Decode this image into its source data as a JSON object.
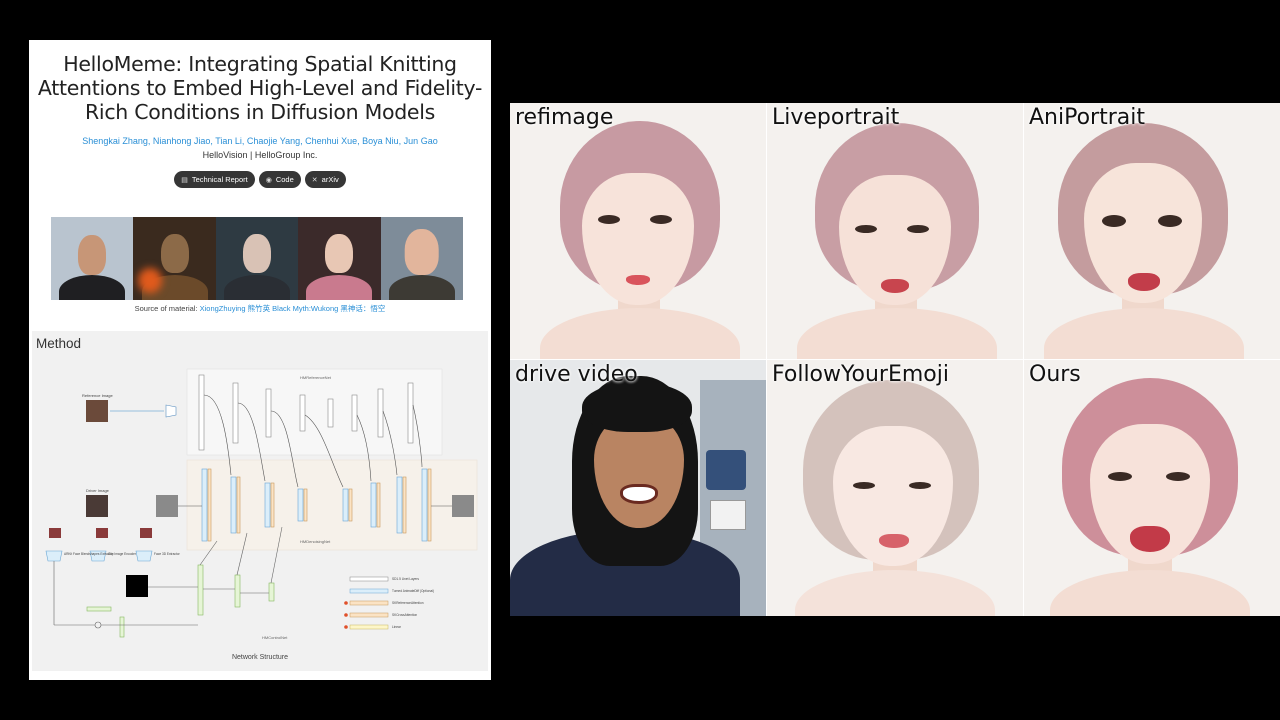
{
  "paper": {
    "title": "HelloMeme: Integrating Spatial Knitting Attentions to Embed High-Level and Fidelity-Rich Conditions in Diffusion Models",
    "authors": "Shengkai Zhang, Nianhong Jiao, Tian Li, Chaojie Yang, Chenhui Xue, Boya Niu, Jun Gao",
    "affiliation": "HelloVision | HelloGroup Inc.",
    "links": [
      {
        "label": "Technical Report",
        "icon": "document-icon"
      },
      {
        "label": "Code",
        "icon": "github-icon"
      },
      {
        "label": "arXiv",
        "icon": "arxiv-icon"
      }
    ],
    "source_prefix": "Source of material: ",
    "source_links": "XiongZhuying 熊竹英 Black Myth:Wukong 黑神话：悟空",
    "method_heading": "Method",
    "network_caption": "Network Structure",
    "diagram": {
      "reference_image": "Reference Image",
      "driver_image": "Driver Image",
      "reference_net": "HMReferenceNet",
      "denoising_net": "HMDenoisingNet",
      "control_net": "HMControlNet",
      "extractor_1": "ARKit Face Blendshapes Extractor",
      "extractor_2": "Clip Image Encoder",
      "extractor_3": "Face 3D Extractor",
      "legend": [
        "SD1.5 Unet Layers",
        "Turned AnimateDiff (Optional)",
        "SKReferenceAttention",
        "SKCrossAttention",
        "Linear"
      ]
    }
  },
  "grid": {
    "labels": [
      "refimage",
      "Liveportrait",
      "AniPortrait",
      "drive video",
      "FollowYourEmoji",
      "Ours"
    ]
  },
  "colors": {
    "link_blue": "#2a8fd6",
    "pill_bg": "#363636",
    "hair_pink": "#c99aa0",
    "skin": "#f6e2d9"
  }
}
